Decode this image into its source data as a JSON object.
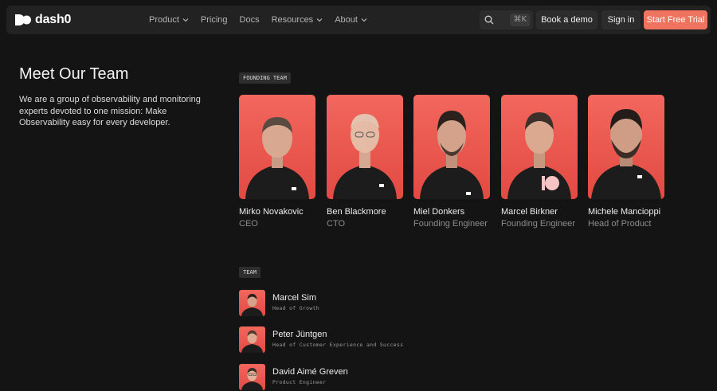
{
  "nav": {
    "logo_text": "dash0",
    "items": [
      {
        "label": "Product",
        "dropdown": true
      },
      {
        "label": "Pricing",
        "dropdown": false
      },
      {
        "label": "Docs",
        "dropdown": false
      },
      {
        "label": "Resources",
        "dropdown": true
      },
      {
        "label": "About",
        "dropdown": true
      }
    ],
    "search_shortcut": "⌘K",
    "book_demo": "Book a demo",
    "sign_in": "Sign in",
    "start_trial": "Start Free Trial"
  },
  "colors": {
    "accent": "#f0735f",
    "background": "#141414",
    "photo_bg": "#e95a50"
  },
  "page": {
    "title": "Meet Our Team",
    "intro": "We are a group of observability and monitoring experts devoted to one mission: Make Observability easy for every developer."
  },
  "founding": {
    "tag": "FOUNDING TEAM",
    "members": [
      {
        "name": "Mirko Novakovic",
        "role": "CEO"
      },
      {
        "name": "Ben Blackmore",
        "role": "CTO"
      },
      {
        "name": "Miel Donkers",
        "role": "Founding Engineer"
      },
      {
        "name": "Marcel Birkner",
        "role": "Founding Engineer"
      },
      {
        "name": "Michele Mancioppi",
        "role": "Head of Product"
      }
    ]
  },
  "team": {
    "tag": "TEAM",
    "members": [
      {
        "name": "Marcel Sim",
        "role": "Head of Growth"
      },
      {
        "name": "Peter Jüntgen",
        "role": "Head of Customer Experience and Success"
      },
      {
        "name": "David Aimé Greven",
        "role": "Product Engineer"
      }
    ]
  }
}
